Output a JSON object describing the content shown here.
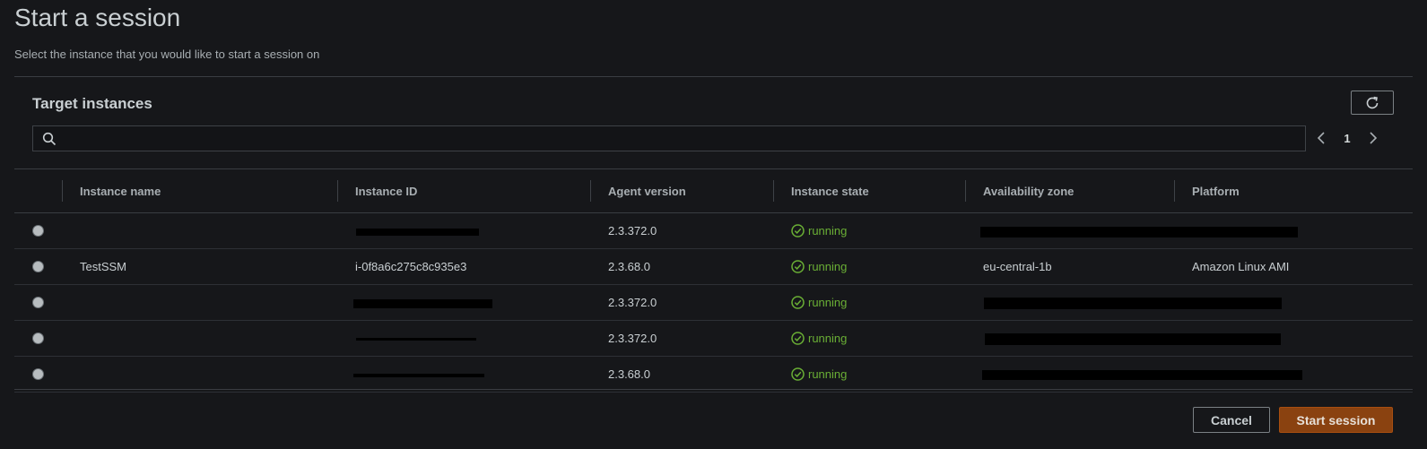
{
  "page": {
    "title": "Start a session",
    "subtitle": "Select the instance that you would like to start a session on"
  },
  "panel": {
    "title": "Target instances",
    "search_value": "",
    "search_placeholder": "",
    "page_number": "1"
  },
  "table": {
    "columns": [
      "Instance name",
      "Instance ID",
      "Agent version",
      "Instance state",
      "Availability zone",
      "Platform"
    ],
    "rows": [
      {
        "name": "",
        "id": "",
        "agent": "2.3.372.0",
        "state": "running",
        "zone": "",
        "platform": ""
      },
      {
        "name": "TestSSM",
        "id": "i-0f8a6c275c8c935e3",
        "agent": "2.3.68.0",
        "state": "running",
        "zone": "eu-central-1b",
        "platform": "Amazon Linux AMI"
      },
      {
        "name": "",
        "id": "",
        "agent": "2.3.372.0",
        "state": "running",
        "zone": "",
        "platform": ""
      },
      {
        "name": "",
        "id": "",
        "agent": "2.3.372.0",
        "state": "running",
        "zone": "",
        "platform": ""
      },
      {
        "name": "",
        "id": "",
        "agent": "2.3.68.0",
        "state": "running",
        "zone": "",
        "platform": ""
      }
    ]
  },
  "footer": {
    "cancel_label": "Cancel",
    "start_label": "Start session"
  },
  "icons": {
    "refresh": "refresh-icon",
    "search": "search-icon",
    "prev": "chevron-left-icon",
    "next": "chevron-right-icon",
    "status": "check-circle-icon"
  },
  "colors": {
    "running": "#6aaf35",
    "primary_button": "#8a4210",
    "background": "#16171a"
  }
}
